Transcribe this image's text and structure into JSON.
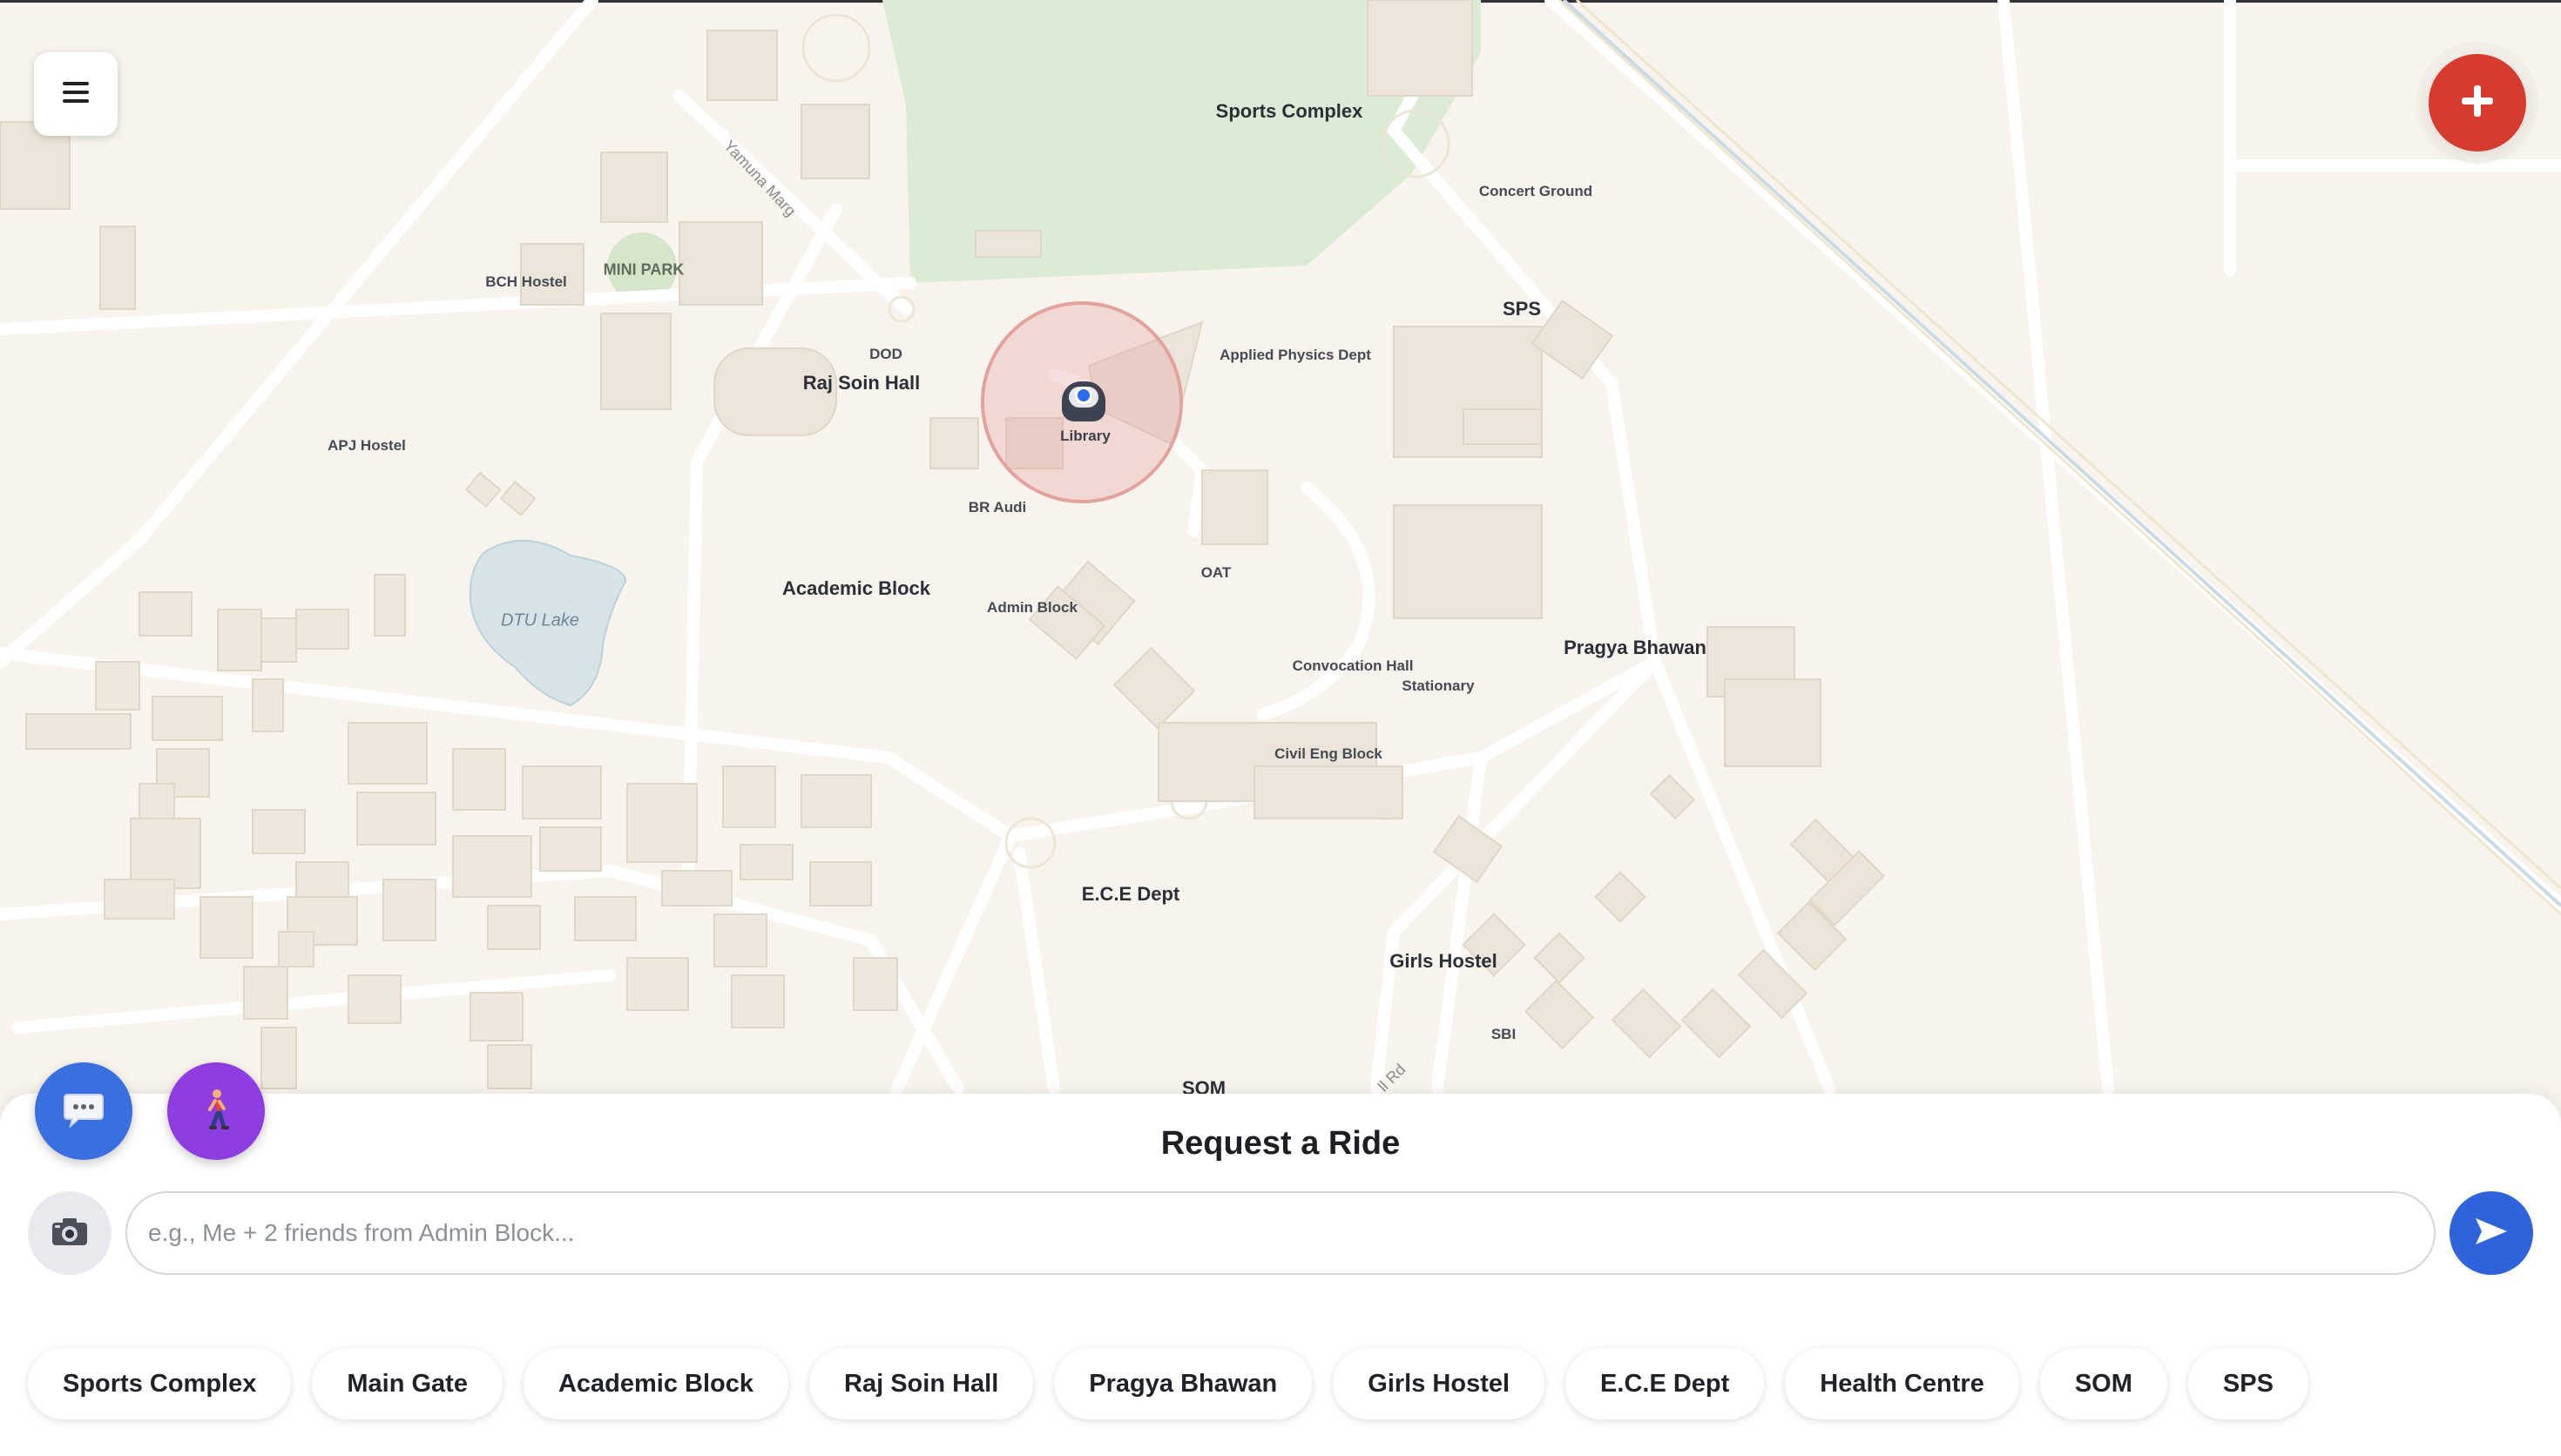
{
  "map": {
    "labels": [
      {
        "key": "sports-complex",
        "text": "Sports Complex",
        "style": "major"
      },
      {
        "key": "concert-ground",
        "text": "Concert Ground",
        "style": "minor"
      },
      {
        "key": "yamuna-marg",
        "text": "Yamuna Marg",
        "style": "road"
      },
      {
        "key": "mini-park",
        "text": "MINI PARK",
        "style": "park"
      },
      {
        "key": "bch-hostel",
        "text": "BCH Hostel",
        "style": "minor"
      },
      {
        "key": "dod",
        "text": "DOD",
        "style": "minor"
      },
      {
        "key": "raj-soin-hall",
        "text": "Raj Soin Hall",
        "style": "major"
      },
      {
        "key": "applied-physics-dept",
        "text": "Applied Physics Dept",
        "style": "minor"
      },
      {
        "key": "sps",
        "text": "SPS",
        "style": "major"
      },
      {
        "key": "apj-hostel",
        "text": "APJ Hostel",
        "style": "minor"
      },
      {
        "key": "br-audi",
        "text": "BR Audi",
        "style": "minor"
      },
      {
        "key": "dtu-lake",
        "text": "DTU Lake",
        "style": "lake"
      },
      {
        "key": "academic-block",
        "text": "Academic Block",
        "style": "major"
      },
      {
        "key": "admin-block",
        "text": "Admin Block",
        "style": "minor"
      },
      {
        "key": "oat",
        "text": "OAT",
        "style": "minor"
      },
      {
        "key": "pragya-bhawan",
        "text": "Pragya Bhawan",
        "style": "major"
      },
      {
        "key": "convocation-hall",
        "text": "Convocation Hall",
        "style": "minor"
      },
      {
        "key": "stationary",
        "text": "Stationary",
        "style": "minor"
      },
      {
        "key": "civil-eng-block",
        "text": "Civil Eng Block",
        "style": "minor"
      },
      {
        "key": "ece-dept",
        "text": "E.C.E Dept",
        "style": "major"
      },
      {
        "key": "girls-hostel",
        "text": "Girls Hostel",
        "style": "major"
      },
      {
        "key": "sbi",
        "text": "SBI",
        "style": "minor"
      },
      {
        "key": "som",
        "text": "SOM",
        "style": "major"
      },
      {
        "key": "hill-rd",
        "text": "ll Rd",
        "style": "road"
      }
    ],
    "current_location_label": "Library"
  },
  "controls": {
    "menu_icon": "hamburger-menu-icon",
    "add_icon": "plus-icon",
    "chat_icon": "chat-bubble-icon",
    "walk_icon": "walking-person-icon",
    "camera_icon": "camera-icon",
    "send_icon": "send-arrow-icon"
  },
  "ride_panel": {
    "title": "Request a Ride",
    "input_value": "",
    "input_placeholder": "e.g., Me + 2 friends from Admin Block..."
  },
  "quick_destinations": [
    "Sports Complex",
    "Main Gate",
    "Academic Block",
    "Raj Soin Hall",
    "Pragya Bhawan",
    "Girls Hostel",
    "E.C.E Dept",
    "Health Centre",
    "SOM",
    "SPS"
  ],
  "colors": {
    "map_background": "#f8f4ed",
    "add_button": "#d63b2f",
    "chat_button": "#3a6fe0",
    "walk_button": "#8e3de0",
    "send_button": "#2f63dc",
    "location_ring": "#e2a09a",
    "location_dot": "#2b6bf0"
  }
}
